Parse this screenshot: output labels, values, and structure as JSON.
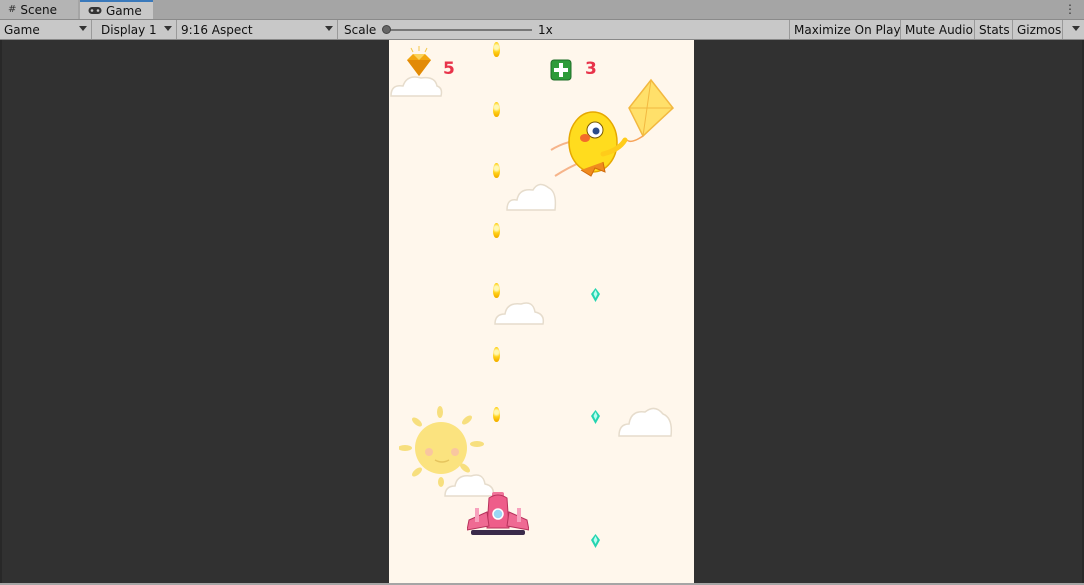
{
  "tabs": [
    {
      "label": "Scene",
      "icon": "grid-icon"
    },
    {
      "label": "Game",
      "icon": "gamepad-icon"
    }
  ],
  "toolbar": {
    "display_mode": "Game",
    "display": "Display 1",
    "aspect": "9:16 Aspect",
    "scale_label": "Scale",
    "scale_value": "1x",
    "maximize": "Maximize On Play",
    "mute": "Mute Audio",
    "stats": "Stats",
    "gizmos": "Gizmos"
  },
  "hud": {
    "diamonds": "5",
    "health": "3"
  },
  "colors": {
    "hud_text": "#e8334a",
    "game_bg": "#fff7ec",
    "editor_bg": "#313131"
  }
}
